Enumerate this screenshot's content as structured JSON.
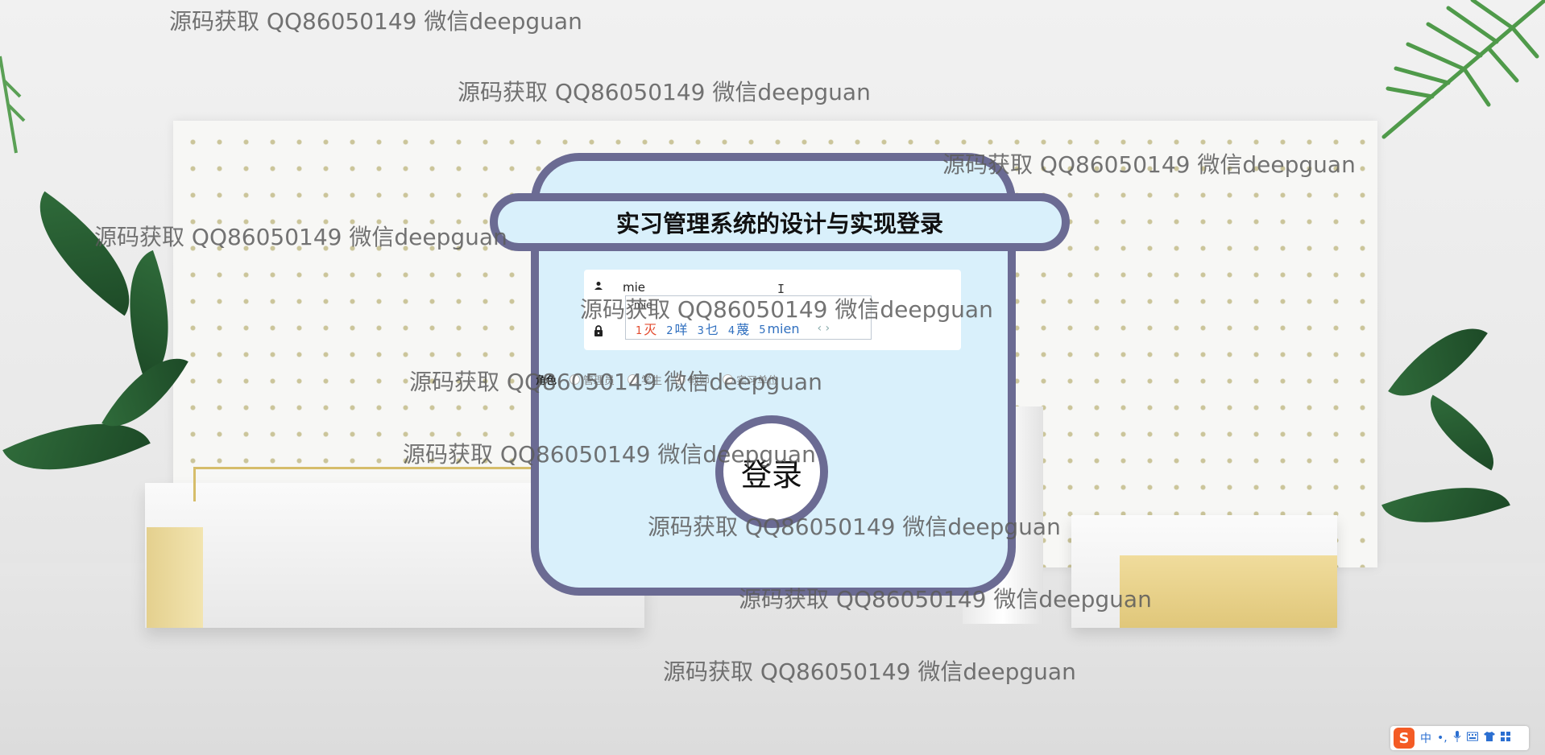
{
  "login": {
    "title": "实习管理系统的设计与实现登录",
    "username_value": "mie",
    "password_value": "",
    "button_label": "登录",
    "role_label": "角色",
    "roles": [
      "管理员",
      "学生",
      "教师",
      "实习单位"
    ]
  },
  "ime": {
    "pinyin": "mie",
    "candidates": [
      {
        "num": "1",
        "text": "灭"
      },
      {
        "num": "2",
        "text": "咩"
      },
      {
        "num": "3",
        "text": "乜"
      },
      {
        "num": "4",
        "text": "蔑"
      },
      {
        "num": "5",
        "text": "mien"
      }
    ],
    "prev_arrow": "‹",
    "next_arrow": "›"
  },
  "toolbar": {
    "logo": "S",
    "lang": "中",
    "punct": "•,",
    "mic_icon": "microphone-icon",
    "keyboard_icon": "keyboard-icon",
    "skin_icon": "shirt-icon",
    "tools_icon": "grid-icon"
  },
  "watermark": "源码获取 QQ86050149 微信deepguan",
  "colors": {
    "card_bg": "#d9f0fb",
    "card_border": "#6b6b93",
    "ime_first": "#e34b2f",
    "ime_cand": "#2f6fbf"
  }
}
